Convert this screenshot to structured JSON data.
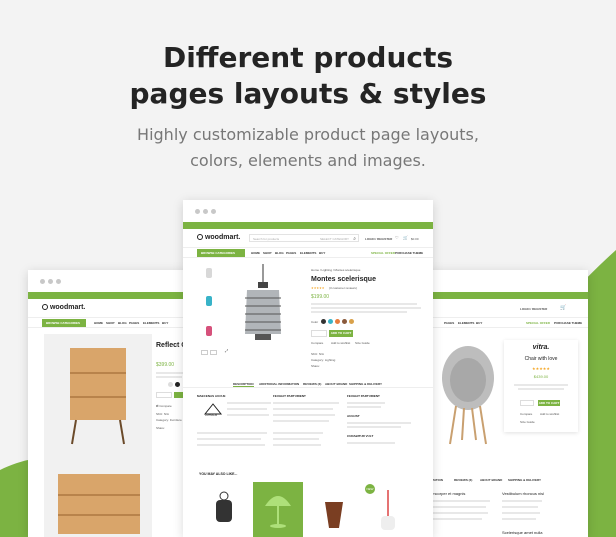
{
  "headline": {
    "line1": "Different products",
    "line2": "pages layouts & styles"
  },
  "subtitle": {
    "line1": "Highly customizable product page layouts,",
    "line2": "colors, elements and images."
  },
  "colors": {
    "accent": "#7cb342",
    "background": "#f3f3f3"
  },
  "left": {
    "logo": "woodmart.",
    "browse": "BROWSE CATEGORIES",
    "nav": [
      "HOME",
      "SHOP",
      "BLOG",
      "PAGES",
      "ELEMENTS",
      "BUY"
    ],
    "title": "Reflect C",
    "price": "$399.00",
    "sku": "SKU: N/A",
    "category": "Category: Furniture",
    "share": "Share:"
  },
  "center": {
    "logo": "woodmart.",
    "search_placeholder": "Search for products",
    "select_category": "SELECT CATEGORY",
    "login": "LOGIN / REGISTER",
    "cart_total": "$0.00",
    "browse": "BROWSE CATEGORIES",
    "nav": [
      "HOME",
      "SHOP",
      "BLOG",
      "PAGES",
      "ELEMENTS",
      "BUY"
    ],
    "special_offer": "SPECIAL OFFER",
    "purchase_theme": "PURCHASE THEME",
    "breadcrumb": "Home / Lighting / Montes scelerisque",
    "title": "Montes scelerisque",
    "reviews": "(3 customer reviews)",
    "price": "$199.00",
    "color_label": "Color",
    "add_to_cart": "ADD TO CART",
    "compare": "Compare",
    "wishlist": "Add to wishlist",
    "size_guide": "Size Guide",
    "sku": "SKU: N/A",
    "category": "Category: Lighting",
    "share": "Share:",
    "tabs": [
      "DESCRIPTION",
      "ADDITIONAL INFORMATION",
      "REVIEWS (3)",
      "ABOUT BRAND",
      "SHIPPING & DELIVERY"
    ],
    "col1_title": "MAECENAS AUCUE",
    "col2_title": "FEUGIAT PARTURIENT",
    "col3_title": "FEUGIAT PARTURIENT",
    "col3_title2": "AUGUST",
    "col3_title3": "CURABITUR VULT",
    "brand": "JOHNSON",
    "related": "YOU MAY ALSO LIKE...",
    "new_badge": "NEW"
  },
  "right": {
    "brand": "vitra.",
    "title": "Chair with love",
    "price": "$439.00",
    "add_to_cart": "ADD TO CART",
    "compare": "Compare",
    "wishlist": "Add to wishlist",
    "size_guide": "Size Guide",
    "special_offer": "SPECIAL OFFER",
    "login": "LOGIN / REGISTER",
    "tabs": [
      "INFORMATION",
      "REVIEWS (3)",
      "ABOUT BRAND",
      "SHIPPING & DELIVERY"
    ],
    "col1_title": "ullamcorper et magnis",
    "col2_title": "Vestibulum rhoncus nisl",
    "col2_title2": "Scelerisque amet nulla"
  }
}
